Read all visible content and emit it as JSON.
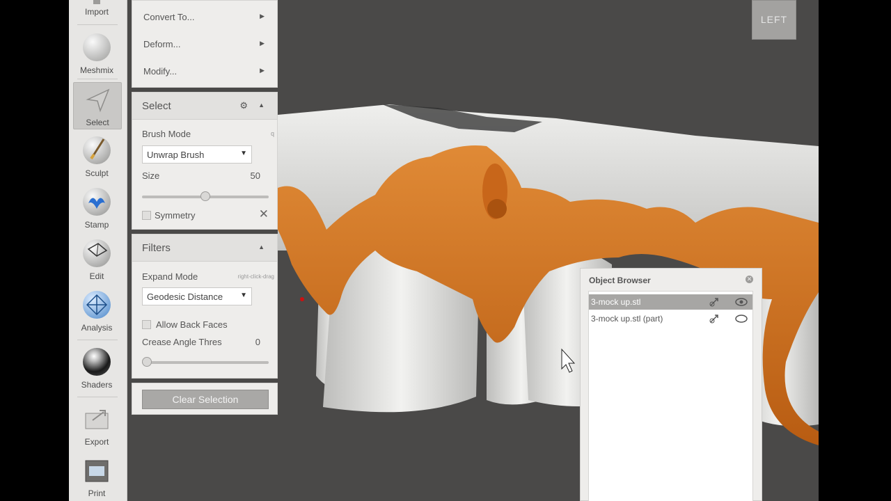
{
  "toolbar": {
    "items": [
      {
        "label": "Import",
        "icon": "import-icon"
      },
      {
        "label": "Meshmix",
        "icon": "meshmix-icon"
      },
      {
        "label": "Select",
        "icon": "select-arrow-icon",
        "active": true
      },
      {
        "label": "Sculpt",
        "icon": "sculpt-brush-icon"
      },
      {
        "label": "Stamp",
        "icon": "stamp-icon"
      },
      {
        "label": "Edit",
        "icon": "edit-icon"
      },
      {
        "label": "Analysis",
        "icon": "analysis-icon"
      },
      {
        "label": "Shaders",
        "icon": "shaders-sphere-icon"
      },
      {
        "label": "Export",
        "icon": "export-icon"
      },
      {
        "label": "Print",
        "icon": "print-icon"
      }
    ]
  },
  "edit_menu": {
    "items": [
      "Convert To...",
      "Deform...",
      "Modify..."
    ]
  },
  "select_panel": {
    "title": "Select",
    "brush_mode_label": "Brush Mode",
    "brush_mode_hint": "q",
    "brush_mode_value": "Unwrap Brush",
    "size_label": "Size",
    "size_value": "50",
    "size_fraction": 0.5,
    "symmetry_label": "Symmetry"
  },
  "filters_panel": {
    "title": "Filters",
    "expand_mode_label": "Expand Mode",
    "expand_mode_hint": "right-click-drag",
    "expand_mode_value": "Geodesic Distance",
    "allow_back_faces_label": "Allow Back Faces",
    "crease_label": "Crease Angle Thres",
    "crease_value": "0",
    "crease_fraction": 0.0
  },
  "clear_selection_label": "Clear Selection",
  "object_browser": {
    "title": "Object Browser",
    "objects": [
      {
        "name": "3-mock up.stl",
        "selected": true
      },
      {
        "name": "3-mock up.stl (part)",
        "selected": false
      }
    ]
  },
  "viewcube_label": "LEFT",
  "colors": {
    "selection": "#d9731c",
    "mesh": "#d8d8d6",
    "background": "#4a4948"
  }
}
